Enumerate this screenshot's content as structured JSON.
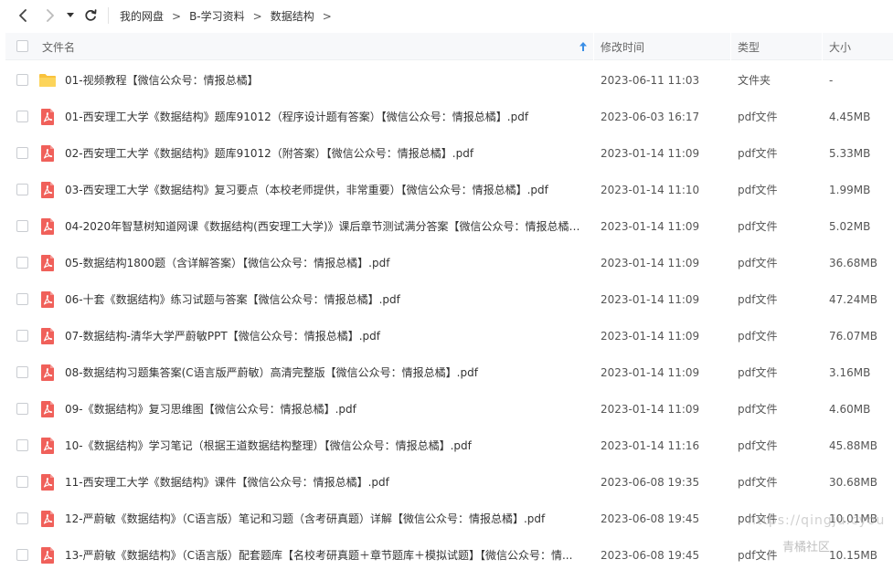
{
  "breadcrumb": {
    "items": [
      "我的网盘",
      "B-学习资料",
      "数据结构"
    ],
    "separator": ">"
  },
  "columns": {
    "name": "文件名",
    "modified": "修改时间",
    "type": "类型",
    "size": "大小"
  },
  "colors": {
    "folder": "#f9c23c",
    "pdf": "#f0605a",
    "sort_arrow": "#3a8ee6",
    "header_bg": "#f7f8fa"
  },
  "files": [
    {
      "icon": "folder-icon",
      "name": "01-视频教程【微信公众号：情报总橘】",
      "modified": "2023-06-11 11:03",
      "type": "文件夹",
      "size": "-"
    },
    {
      "icon": "pdf-icon",
      "name": "01-西安理工大学《数据结构》题库91012（程序设计题有答案）【微信公众号：情报总橘】.pdf",
      "modified": "2023-06-03 16:17",
      "type": "pdf文件",
      "size": "4.45MB"
    },
    {
      "icon": "pdf-icon",
      "name": "02-西安理工大学《数据结构》题库91012（附答案）【微信公众号：情报总橘】.pdf",
      "modified": "2023-01-14 11:09",
      "type": "pdf文件",
      "size": "5.33MB"
    },
    {
      "icon": "pdf-icon",
      "name": "03-西安理工大学《数据结构》复习要点（本校老师提供，非常重要）【微信公众号：情报总橘】.pdf",
      "modified": "2023-01-14 11:10",
      "type": "pdf文件",
      "size": "1.99MB"
    },
    {
      "icon": "pdf-icon",
      "name": "04-2020年智慧树知道网课《数据结构(西安理工大学)》课后章节测试满分答案【微信公众号：情报总橘】...",
      "modified": "2023-01-14 11:09",
      "type": "pdf文件",
      "size": "5.02MB"
    },
    {
      "icon": "pdf-icon",
      "name": "05-数据结构1800题（含详解答案）【微信公众号：情报总橘】.pdf",
      "modified": "2023-01-14 11:09",
      "type": "pdf文件",
      "size": "36.68MB"
    },
    {
      "icon": "pdf-icon",
      "name": "06-十套《数据结构》练习试题与答案【微信公众号：情报总橘】.pdf",
      "modified": "2023-01-14 11:09",
      "type": "pdf文件",
      "size": "47.24MB"
    },
    {
      "icon": "pdf-icon",
      "name": "07-数据结构-清华大学严蔚敏PPT【微信公众号：情报总橘】.pdf",
      "modified": "2023-01-14 11:09",
      "type": "pdf文件",
      "size": "76.07MB"
    },
    {
      "icon": "pdf-icon",
      "name": "08-数据结构习题集答案(C语言版严蔚敏）高清完整版【微信公众号：情报总橘】.pdf",
      "modified": "2023-01-14 11:09",
      "type": "pdf文件",
      "size": "3.16MB"
    },
    {
      "icon": "pdf-icon",
      "name": "09-《数据结构》复习思维图【微信公众号：情报总橘】.pdf",
      "modified": "2023-01-14 11:09",
      "type": "pdf文件",
      "size": "4.60MB"
    },
    {
      "icon": "pdf-icon",
      "name": "10-《数据结构》学习笔记（根据王道数据结构整理）【微信公众号：情报总橘】.pdf",
      "modified": "2023-01-14 11:16",
      "type": "pdf文件",
      "size": "45.88MB"
    },
    {
      "icon": "pdf-icon",
      "name": "11-西安理工大学《数据结构》课件【微信公众号：情报总橘】.pdf",
      "modified": "2023-06-08 19:35",
      "type": "pdf文件",
      "size": "30.68MB"
    },
    {
      "icon": "pdf-icon",
      "name": "12-严蔚敏《数据结构》（C语言版）笔记和习题（含考研真题）详解【微信公众号：情报总橘】.pdf",
      "modified": "2023-06-08 19:45",
      "type": "pdf文件",
      "size": "10.01MB"
    },
    {
      "icon": "pdf-icon",
      "name": "13-严蔚敏《数据结构》（C语言版）配套题库【名校考研真题＋章节题库＋模拟试题】【微信公众号：情...",
      "modified": "2023-06-08 19:45",
      "type": "pdf文件",
      "size": "10.15MB"
    }
  ],
  "watermark": {
    "url": "https://qingju.cyou",
    "name": "青橘社区"
  }
}
